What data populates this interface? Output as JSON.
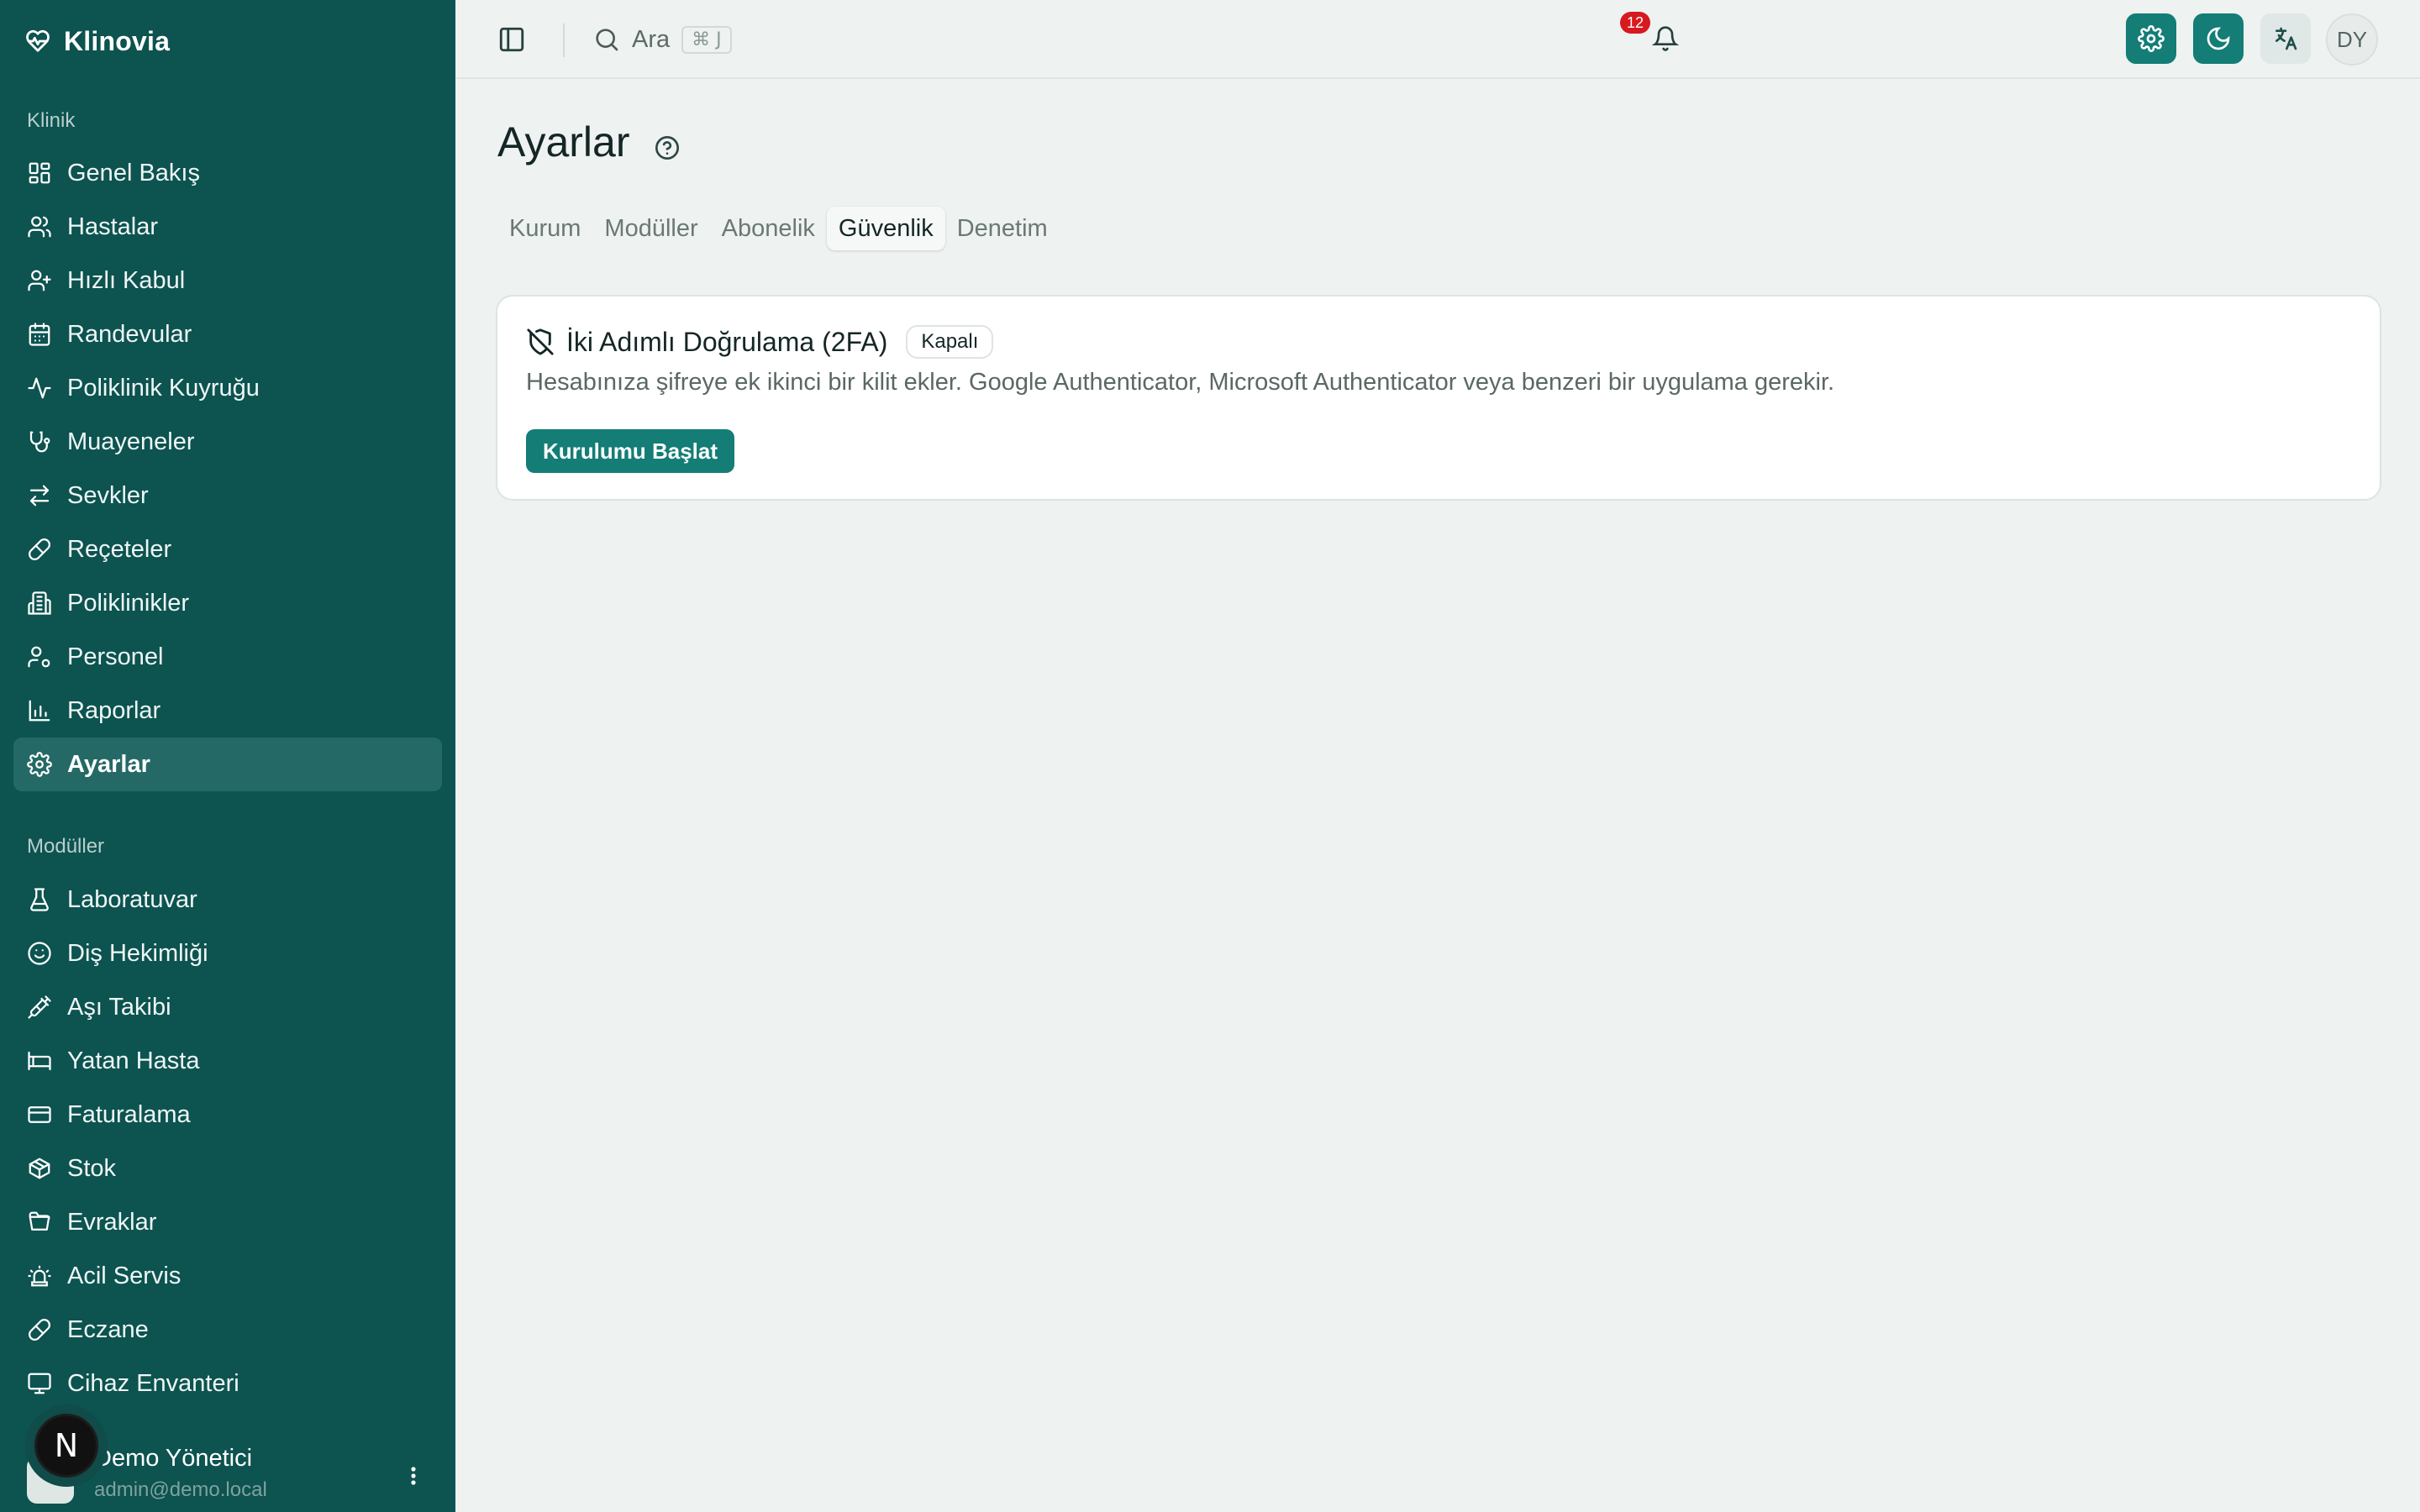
{
  "app": {
    "name": "Klinovia"
  },
  "sidebar": {
    "groups": [
      {
        "label": "Klinik"
      },
      {
        "label": "Modüller"
      }
    ],
    "klinik_items": [
      {
        "label": "Genel Bakış",
        "icon": "dashboard-icon"
      },
      {
        "label": "Hastalar",
        "icon": "users-icon"
      },
      {
        "label": "Hızlı Kabul",
        "icon": "user-plus-icon"
      },
      {
        "label": "Randevular",
        "icon": "calendar-icon"
      },
      {
        "label": "Poliklinik Kuyruğu",
        "icon": "activity-icon"
      },
      {
        "label": "Muayeneler",
        "icon": "stethoscope-icon"
      },
      {
        "label": "Sevkler",
        "icon": "arrows-icon"
      },
      {
        "label": "Reçeteler",
        "icon": "pill-icon"
      },
      {
        "label": "Poliklinikler",
        "icon": "building-icon"
      },
      {
        "label": "Personel",
        "icon": "user-cog-icon"
      },
      {
        "label": "Raporlar",
        "icon": "bar-chart-icon"
      },
      {
        "label": "Ayarlar",
        "icon": "gear-icon",
        "active": true
      }
    ],
    "modul_items": [
      {
        "label": "Laboratuvar",
        "icon": "flask-icon"
      },
      {
        "label": "Diş Hekimliği",
        "icon": "smile-icon"
      },
      {
        "label": "Aşı Takibi",
        "icon": "syringe-icon"
      },
      {
        "label": "Yatan Hasta",
        "icon": "bed-icon"
      },
      {
        "label": "Faturalama",
        "icon": "credit-card-icon"
      },
      {
        "label": "Stok",
        "icon": "package-icon"
      },
      {
        "label": "Evraklar",
        "icon": "folder-icon"
      },
      {
        "label": "Acil Servis",
        "icon": "siren-icon"
      },
      {
        "label": "Eczane",
        "icon": "pill-icon"
      },
      {
        "label": "Cihaz Envanteri",
        "icon": "monitor-icon"
      }
    ],
    "user": {
      "name": "Demo Yönetici",
      "email": "admin@demo.local"
    },
    "framework_badge": "N"
  },
  "header": {
    "search_label": "Ara",
    "search_shortcut": "⌘ J",
    "notification_count": "12",
    "avatar_initials": "DY"
  },
  "main": {
    "title": "Ayarlar",
    "tabs": [
      {
        "label": "Kurum"
      },
      {
        "label": "Modüller"
      },
      {
        "label": "Abonelik"
      },
      {
        "label": "Güvenlik",
        "active": true
      },
      {
        "label": "Denetim"
      }
    ],
    "card": {
      "title": "İki Adımlı Doğrulama (2FA)",
      "status": "Kapalı",
      "description": "Hesabınıza şifreye ek ikinci bir kilit ekler. Google Authenticator, Microsoft Authenticator veya benzeri bir uygulama gerekir.",
      "button": "Kurulumu Başlat"
    }
  },
  "colors": {
    "sidebar_bg": "#0d5350",
    "accent": "#137d76",
    "page_bg": "#eef2f0",
    "badge_red": "#d71920"
  }
}
